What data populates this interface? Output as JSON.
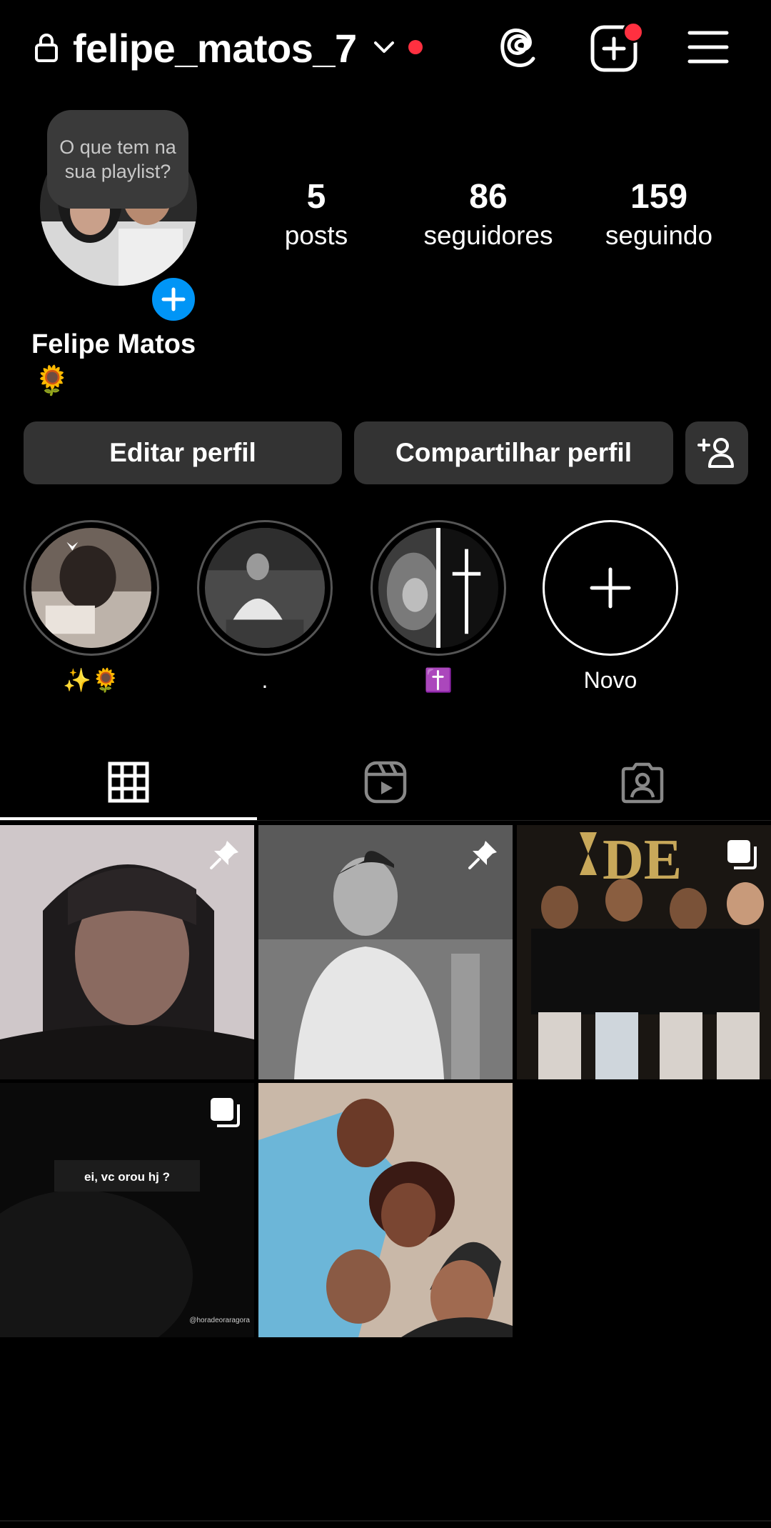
{
  "header": {
    "username": "felipe_matos_7",
    "has_notification_dot": true
  },
  "profile": {
    "note": "O que tem na sua playlist?",
    "full_name": "Felipe Matos",
    "bio": "🌻",
    "stats": [
      {
        "value": "5",
        "label": "posts"
      },
      {
        "value": "86",
        "label": "seguidores"
      },
      {
        "value": "159",
        "label": "seguindo"
      }
    ]
  },
  "actions": {
    "edit_profile": "Editar perfil",
    "share_profile": "Compartilhar perfil"
  },
  "highlights": [
    {
      "label": "✨🌻"
    },
    {
      "label": "."
    },
    {
      "label": "✝️"
    },
    {
      "label": "Novo"
    }
  ],
  "tabs": [
    "posts-grid",
    "reels",
    "tagged"
  ],
  "posts": [
    {
      "pinned": true,
      "multi": false
    },
    {
      "pinned": true,
      "multi": false
    },
    {
      "pinned": false,
      "multi": true,
      "overlay_text": "DE"
    },
    {
      "pinned": false,
      "multi": true,
      "overlay_text": "ei, vc orou hj ?",
      "credit": "@horadeoraragora"
    },
    {
      "pinned": false,
      "multi": false
    }
  ],
  "colors": {
    "background": "#000000",
    "button": "#333333",
    "accent_blue": "#0095f6",
    "notification_red": "#ff3040"
  }
}
